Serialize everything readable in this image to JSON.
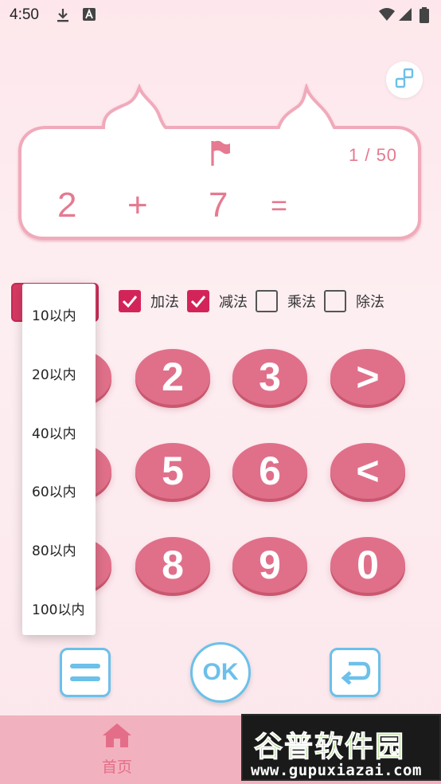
{
  "status_bar": {
    "time": "4:50",
    "icons": [
      "download-icon",
      "text-a-icon",
      "wifi-icon",
      "signal-icon",
      "battery-icon"
    ]
  },
  "question_card": {
    "progress": "1 / 50",
    "operand1": "2",
    "operator": "+",
    "operand2": "7",
    "equals": "=",
    "answer": ""
  },
  "operations": [
    {
      "label": "加法",
      "checked": true
    },
    {
      "label": "减法",
      "checked": true
    },
    {
      "label": "乘法",
      "checked": false
    },
    {
      "label": "除法",
      "checked": false
    }
  ],
  "range_dropdown": {
    "options": [
      "10以内",
      "20以内",
      "40以内",
      "60以内",
      "80以内",
      "100以内"
    ]
  },
  "keypad": {
    "keys": [
      "2",
      "3",
      ">",
      "5",
      "6",
      "<",
      "8",
      "9",
      "0"
    ]
  },
  "actions": {
    "ok_label": "OK"
  },
  "bottom_nav": {
    "home_label": "首页"
  },
  "watermark": {
    "title": "谷普软件园",
    "url": "www.gupuxiazai.com"
  },
  "colors": {
    "accent_pink": "#e0708a",
    "checkbox_red": "#d3245a",
    "blue_outline": "#6cc0ea",
    "nav_bar": "#f2b1be"
  }
}
